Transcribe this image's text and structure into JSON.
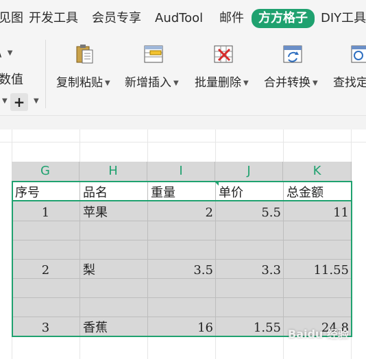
{
  "ribbon": {
    "tabs": [
      {
        "label": "视图",
        "visible_label": "见图",
        "active": false
      },
      {
        "label": "开发工具",
        "active": false
      },
      {
        "label": "会员专享",
        "active": false
      },
      {
        "label": "AudTool",
        "active": false
      },
      {
        "label": "邮件",
        "active": false
      },
      {
        "label": "方方格子",
        "active": true
      },
      {
        "label": "DIY工具",
        "active": false
      }
    ],
    "left_partial": {
      "top_caret_text": "\\ ",
      "value_label": "数值"
    },
    "buttons": [
      {
        "label": "复制粘贴",
        "icon": "clipboard-paste-icon"
      },
      {
        "label": "新增插入",
        "icon": "insert-row-icon"
      },
      {
        "label": "批量删除",
        "icon": "delete-cells-icon"
      },
      {
        "label": "合并转换",
        "icon": "merge-convert-icon"
      },
      {
        "label": "查找定",
        "icon": "find-locate-icon"
      }
    ]
  },
  "sheet": {
    "column_headers": [
      "G",
      "H",
      "I",
      "J",
      "K"
    ],
    "table_headers": [
      "序号",
      "品名",
      "重量",
      "单价",
      "总金额"
    ],
    "rows": [
      {
        "index": "1",
        "name": "苹果",
        "weight": "2",
        "price": "5.5",
        "total": "11"
      },
      {
        "index": "",
        "name": "",
        "weight": "",
        "price": "",
        "total": ""
      },
      {
        "index": "",
        "name": "",
        "weight": "",
        "price": "",
        "total": ""
      },
      {
        "index": "2",
        "name": "梨",
        "weight": "3.5",
        "price": "3.3",
        "total": "11.55"
      },
      {
        "index": "",
        "name": "",
        "weight": "",
        "price": "",
        "total": ""
      },
      {
        "index": "",
        "name": "",
        "weight": "",
        "price": "",
        "total": ""
      },
      {
        "index": "3",
        "name": "香蕉",
        "weight": "16",
        "price": "1.55",
        "total": "24.8"
      }
    ]
  },
  "watermark": "Baidu 经验",
  "colors": {
    "accent": "#1fa16f",
    "selection_fill": "#d8d8d8"
  }
}
